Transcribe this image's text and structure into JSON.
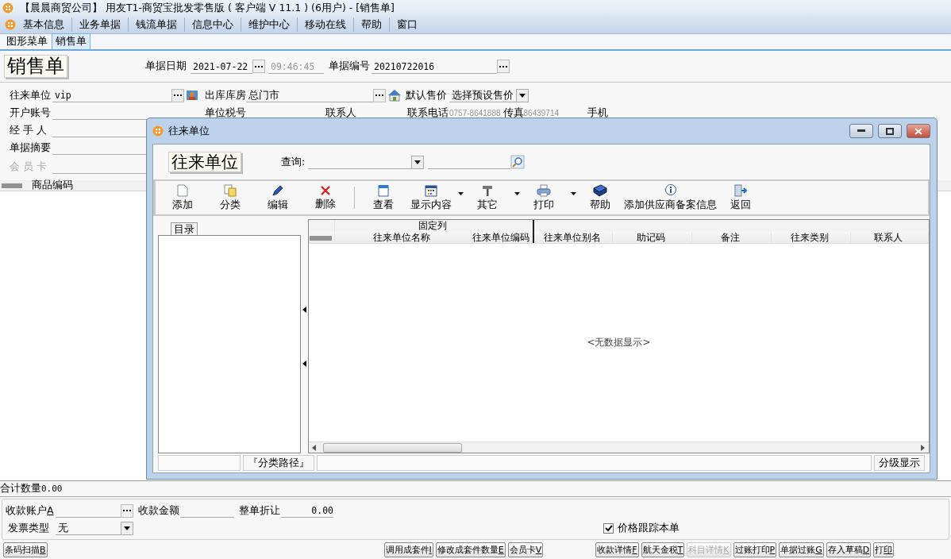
{
  "window": {
    "title": "【晨晨商贸公司】 用友T1-商贸宝批发零售版 ( 客户端 V 11.1 ) (6用户) - [销售单]"
  },
  "menu": [
    "基本信息",
    "业务单据",
    "钱流单据",
    "信息中心",
    "维护中心",
    "移动在线",
    "帮助",
    "窗口"
  ],
  "tabs": [
    {
      "label": "图形菜单",
      "selected": false
    },
    {
      "label": "销售单",
      "selected": true
    }
  ],
  "form": {
    "title": "销售单",
    "date_label": "单据日期",
    "date": "2021-07-22",
    "time": "09:46:45",
    "number_label": "单据编号",
    "number": "20210722016",
    "partner_label": "往来单位",
    "partner": "vip",
    "warehouse_label": "出库库房",
    "warehouse": "总门市",
    "price_label": "默认售价",
    "price": "选择预设售价",
    "account_label": "开户账号",
    "tax_label": "单位税号",
    "contact_label": "联系人",
    "phone_label": "联系电话",
    "phone": "0757-8641888",
    "fax_label": "传真",
    "fax": "86439714",
    "mobile_label": "手机",
    "handler_label": "经 手 人",
    "summary_label": "单据摘要",
    "member_label": "会 员 卡"
  },
  "grid": {
    "columns": [
      "商品编码"
    ]
  },
  "total": {
    "label": "合计数量",
    "value": "0.00"
  },
  "payment": {
    "account_label": "收款账户A",
    "amount_label": "收款金额",
    "discount_label": "整单折让",
    "discount": "0.00",
    "invoice_label": "发票类型",
    "invoice": "无",
    "price_track": {
      "label": "价格跟踪本单",
      "checked": true
    }
  },
  "buttons_left": [
    {
      "label": "条码扫描B",
      "disabled": false
    }
  ],
  "buttons_middle": [
    {
      "label": "调用成套件I",
      "disabled": false
    },
    {
      "label": "修改成套件数量E",
      "disabled": false
    },
    {
      "label": "会员卡V",
      "disabled": false
    }
  ],
  "buttons_right": [
    {
      "label": "收款详情F",
      "disabled": false
    },
    {
      "label": "航天金税T",
      "disabled": false
    },
    {
      "label": "科目详情K",
      "disabled": true
    },
    {
      "label": "过账打印P",
      "disabled": false
    },
    {
      "label": "单据过账G",
      "disabled": false
    },
    {
      "label": "存入草稿D",
      "disabled": false
    },
    {
      "label": "打印",
      "disabled": false
    }
  ],
  "dialog": {
    "title": "往来单位",
    "heading": "往来单位",
    "query_label": "查询:",
    "toolbar": [
      {
        "label": "添加",
        "dropdown": false,
        "divider_before": false
      },
      {
        "label": "分类",
        "dropdown": false,
        "divider_before": false
      },
      {
        "label": "编辑",
        "dropdown": false,
        "divider_before": false
      },
      {
        "label": "删除",
        "dropdown": false,
        "divider_before": false
      },
      {
        "label": "查看",
        "dropdown": false,
        "divider_before": true
      },
      {
        "label": "显示内容",
        "dropdown": true,
        "divider_before": false
      },
      {
        "label": "其它",
        "dropdown": true,
        "divider_before": false
      },
      {
        "label": "打印",
        "dropdown": true,
        "divider_before": false
      },
      {
        "label": "帮助",
        "dropdown": false,
        "divider_before": false
      },
      {
        "label": "添加供应商备案信息",
        "dropdown": false,
        "divider_before": false
      },
      {
        "label": "返回",
        "dropdown": false,
        "divider_before": false
      }
    ],
    "tree_tab": "目录",
    "table": {
      "group": "固定列",
      "fixed_columns": [
        "往来单位名称",
        "往来单位编码"
      ],
      "columns": [
        "往来单位别名",
        "助记码",
        "备注",
        "往来类别",
        "联系人"
      ],
      "empty": "<无数据显示>"
    },
    "status": {
      "path_button": "『分类路径』",
      "level_button": "分级显示"
    }
  }
}
